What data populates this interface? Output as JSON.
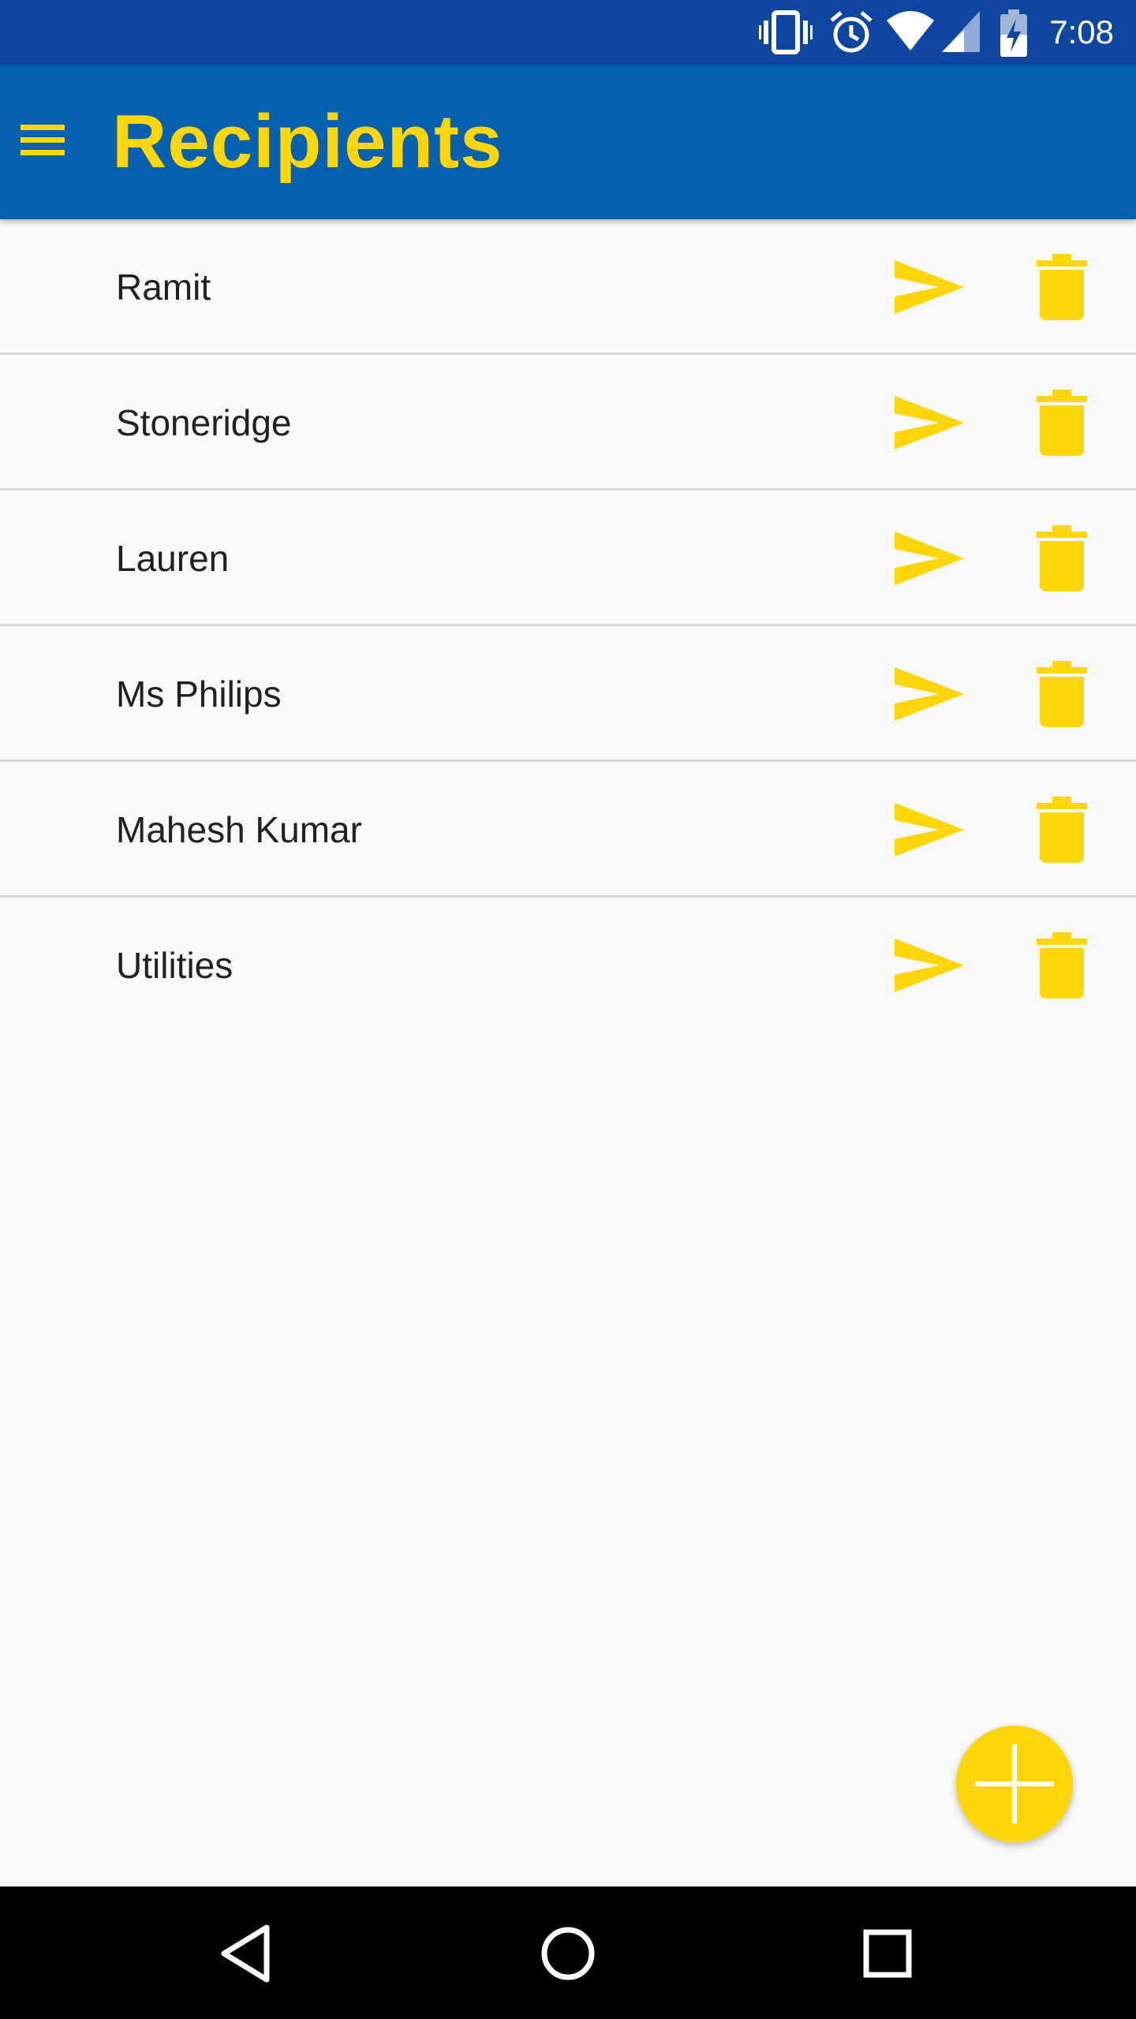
{
  "status_bar": {
    "time": "7:08",
    "icons": [
      "vibrate-icon",
      "alarm-icon",
      "wifi-icon",
      "signal-icon",
      "battery-charging-icon"
    ]
  },
  "app_bar": {
    "title": "Recipients",
    "menu_icon": "hamburger-menu-icon"
  },
  "recipients": [
    {
      "name": "Ramit"
    },
    {
      "name": "Stoneridge"
    },
    {
      "name": "Lauren"
    },
    {
      "name": "Ms Philips"
    },
    {
      "name": "Mahesh Kumar"
    },
    {
      "name": "Utilities"
    }
  ],
  "row_icons": {
    "send": "send-icon",
    "delete": "trash-icon"
  },
  "fab": {
    "icon": "plus-icon"
  },
  "nav_bar": {
    "icons": [
      "back-icon",
      "home-icon",
      "recents-icon"
    ]
  },
  "colors": {
    "status_bar": "#0f46a0",
    "app_bar": "#0560ad",
    "accent": "#ffd60a",
    "background": "#fafafa",
    "divider": "#d9d9d9",
    "nav_bar": "#000000"
  }
}
